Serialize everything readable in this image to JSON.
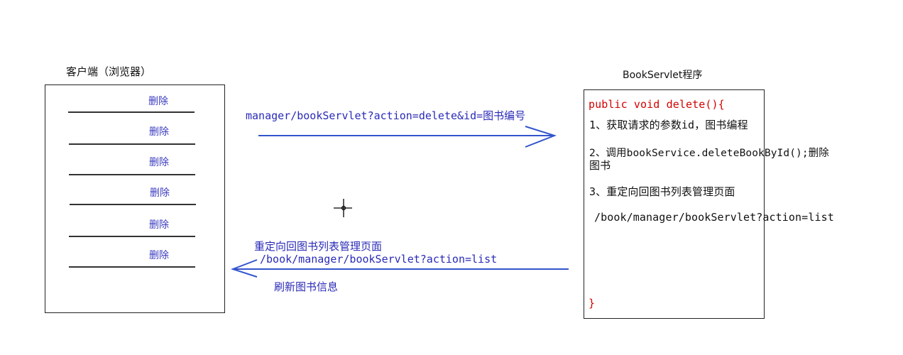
{
  "client": {
    "title": "客户端（浏览器）",
    "rows": [
      {
        "label": "删除"
      },
      {
        "label": "删除"
      },
      {
        "label": "删除"
      },
      {
        "label": "删除"
      },
      {
        "label": "删除"
      },
      {
        "label": "删除"
      }
    ]
  },
  "server": {
    "title": "BookServlet程序",
    "code": {
      "signature": "public void delete(){",
      "step1": "1、获取请求的参数id，图书编程",
      "step2_line1": "2、调用bookService.deleteBookById();删除",
      "step2_line2": "图书",
      "step3": "3、重定向回图书列表管理页面",
      "redirect_url": "/book/manager/bookServlet?action=list",
      "closing_brace": "}"
    }
  },
  "request_arrow": {
    "label": "manager/bookServlet?action=delete&id=图书编号"
  },
  "response_arrow": {
    "line1": "重定向回图书列表管理页面",
    "line2": "/book/manager/bookServlet?action=list",
    "line3": "刷新图书信息"
  },
  "colors": {
    "blue_text": "#2a2ab8",
    "arrow": "#3355cc",
    "code_keyword": "#d40000",
    "border": "#222222"
  },
  "icons": {
    "cursor": "crosshair-cursor-icon"
  }
}
